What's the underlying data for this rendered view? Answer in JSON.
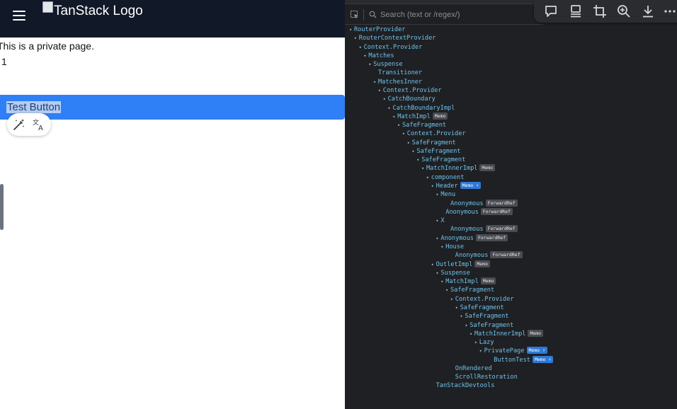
{
  "app": {
    "header": {
      "logo_alt": "TanStack Logo"
    },
    "private_text": "This is a private page.",
    "counter": "1",
    "test_button_label": "Test Button",
    "floating_toolbar": {
      "icons": [
        "magic-wand-icon",
        "translate-icon"
      ]
    }
  },
  "devtools": {
    "search": {
      "placeholder": "Search (text or /regex/)"
    },
    "capture_toolbar": {
      "icons": [
        "comment-icon",
        "device-icon",
        "crop-icon",
        "zoom-in-icon",
        "download-icon",
        "more-icon"
      ]
    },
    "tree": [
      {
        "label": "RouterProvider",
        "depth": 0,
        "arrow": true,
        "badges": []
      },
      {
        "label": "RouterContextProvider",
        "depth": 1,
        "arrow": true,
        "badges": []
      },
      {
        "label": "Context.Provider",
        "depth": 2,
        "arrow": true,
        "badges": []
      },
      {
        "label": "Matches",
        "depth": 3,
        "arrow": true,
        "badges": []
      },
      {
        "label": "Suspense",
        "depth": 4,
        "arrow": true,
        "badges": []
      },
      {
        "label": "Transitioner",
        "depth": 5,
        "arrow": false,
        "badges": []
      },
      {
        "label": "MatchesInner",
        "depth": 5,
        "arrow": true,
        "badges": []
      },
      {
        "label": "Context.Provider",
        "depth": 6,
        "arrow": true,
        "badges": []
      },
      {
        "label": "CatchBoundary",
        "depth": 7,
        "arrow": true,
        "badges": []
      },
      {
        "label": "CatchBoundaryImpl",
        "depth": 8,
        "arrow": true,
        "badges": []
      },
      {
        "label": "MatchImpl",
        "depth": 9,
        "arrow": true,
        "badges": [
          {
            "text": "Memo",
            "blue": false
          }
        ]
      },
      {
        "label": "SafeFragment",
        "depth": 10,
        "arrow": true,
        "badges": []
      },
      {
        "label": "Context.Provider",
        "depth": 11,
        "arrow": true,
        "badges": []
      },
      {
        "label": "SafeFragment",
        "depth": 12,
        "arrow": true,
        "badges": []
      },
      {
        "label": "SafeFragment",
        "depth": 13,
        "arrow": true,
        "badges": []
      },
      {
        "label": "SafeFragment",
        "depth": 14,
        "arrow": true,
        "badges": []
      },
      {
        "label": "MatchInnerImpl",
        "depth": 15,
        "arrow": true,
        "badges": [
          {
            "text": "Memo",
            "blue": false
          }
        ]
      },
      {
        "label": "component",
        "depth": 16,
        "arrow": true,
        "badges": []
      },
      {
        "label": "Header",
        "depth": 17,
        "arrow": true,
        "badges": [
          {
            "text": "Memo ⚡",
            "blue": true
          }
        ]
      },
      {
        "label": "Menu",
        "depth": 18,
        "arrow": true,
        "badges": []
      },
      {
        "label": "Anonymous",
        "depth": 20,
        "arrow": false,
        "badges": [
          {
            "text": "ForwardRef",
            "blue": false
          }
        ]
      },
      {
        "label": "Anonymous",
        "depth": 19,
        "arrow": false,
        "badges": [
          {
            "text": "ForwardRef",
            "blue": false
          }
        ]
      },
      {
        "label": "X",
        "depth": 18,
        "arrow": true,
        "badges": []
      },
      {
        "label": "Anonymous",
        "depth": 20,
        "arrow": false,
        "badges": [
          {
            "text": "ForwardRef",
            "blue": false
          }
        ]
      },
      {
        "label": "Anonymous",
        "depth": 18,
        "arrow": true,
        "badges": [
          {
            "text": "ForwardRef",
            "blue": false
          }
        ]
      },
      {
        "label": "House",
        "depth": 19,
        "arrow": true,
        "badges": []
      },
      {
        "label": "Anonymous",
        "depth": 21,
        "arrow": false,
        "badges": [
          {
            "text": "ForwardRef",
            "blue": false
          }
        ]
      },
      {
        "label": "OutletImpl",
        "depth": 17,
        "arrow": true,
        "badges": [
          {
            "text": "Memo",
            "blue": false
          }
        ]
      },
      {
        "label": "Suspense",
        "depth": 18,
        "arrow": true,
        "badges": []
      },
      {
        "label": "MatchImpl",
        "depth": 19,
        "arrow": true,
        "badges": [
          {
            "text": "Memo",
            "blue": false
          }
        ]
      },
      {
        "label": "SafeFragment",
        "depth": 20,
        "arrow": true,
        "badges": []
      },
      {
        "label": "Context.Provider",
        "depth": 21,
        "arrow": true,
        "badges": []
      },
      {
        "label": "SafeFragment",
        "depth": 22,
        "arrow": true,
        "badges": []
      },
      {
        "label": "SafeFragment",
        "depth": 23,
        "arrow": true,
        "badges": []
      },
      {
        "label": "SafeFragment",
        "depth": 24,
        "arrow": true,
        "badges": []
      },
      {
        "label": "MatchInnerImpl",
        "depth": 25,
        "arrow": true,
        "badges": [
          {
            "text": "Memo",
            "blue": false
          }
        ]
      },
      {
        "label": "Lazy",
        "depth": 26,
        "arrow": true,
        "badges": []
      },
      {
        "label": "PrivatePage",
        "depth": 27,
        "arrow": true,
        "badges": [
          {
            "text": "Memo ⚡",
            "blue": true
          }
        ]
      },
      {
        "label": "ButtonTest",
        "depth": 29,
        "arrow": false,
        "badges": [
          {
            "text": "Memo ⚡",
            "blue": true
          }
        ]
      },
      {
        "label": "OnRendered",
        "depth": 21,
        "arrow": false,
        "badges": []
      },
      {
        "label": "ScrollRestoration",
        "depth": 21,
        "arrow": false,
        "badges": []
      },
      {
        "label": "TanStackDevtools",
        "depth": 17,
        "arrow": false,
        "badges": []
      }
    ]
  }
}
